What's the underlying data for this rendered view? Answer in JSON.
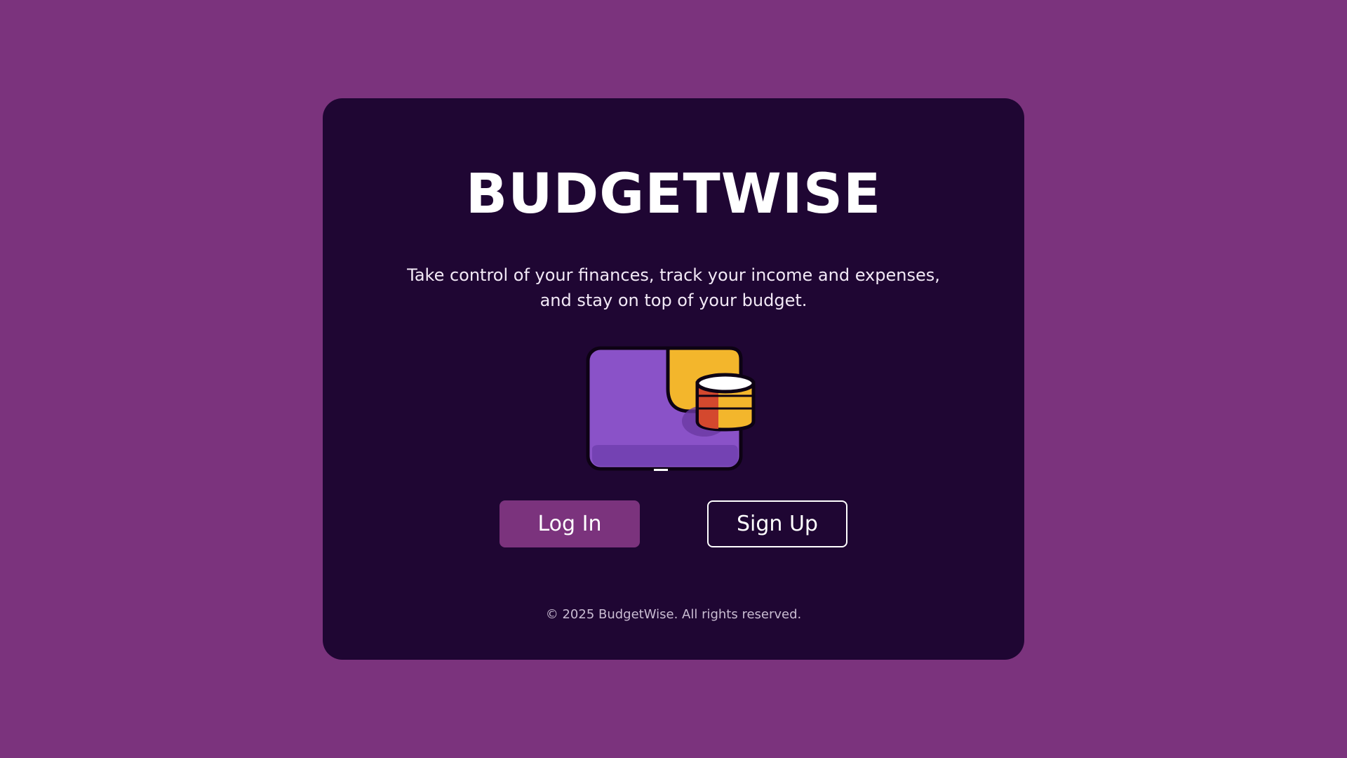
{
  "app": {
    "title": "BUDGETWISE",
    "tagline_line1": "Take control of your finances, track your income and expenses,",
    "tagline_line2": "and stay on top of your budget."
  },
  "illustration": {
    "icon": "wallet-with-coins-icon"
  },
  "actions": {
    "login_label": "Log In",
    "signup_label": "Sign Up"
  },
  "footer": {
    "copyright": "© 2025 BudgetWise. All rights reserved."
  },
  "colors": {
    "background": "#7b337d",
    "card": "#1f0633",
    "primary_button": "#7b337d",
    "text": "#ffffff"
  }
}
